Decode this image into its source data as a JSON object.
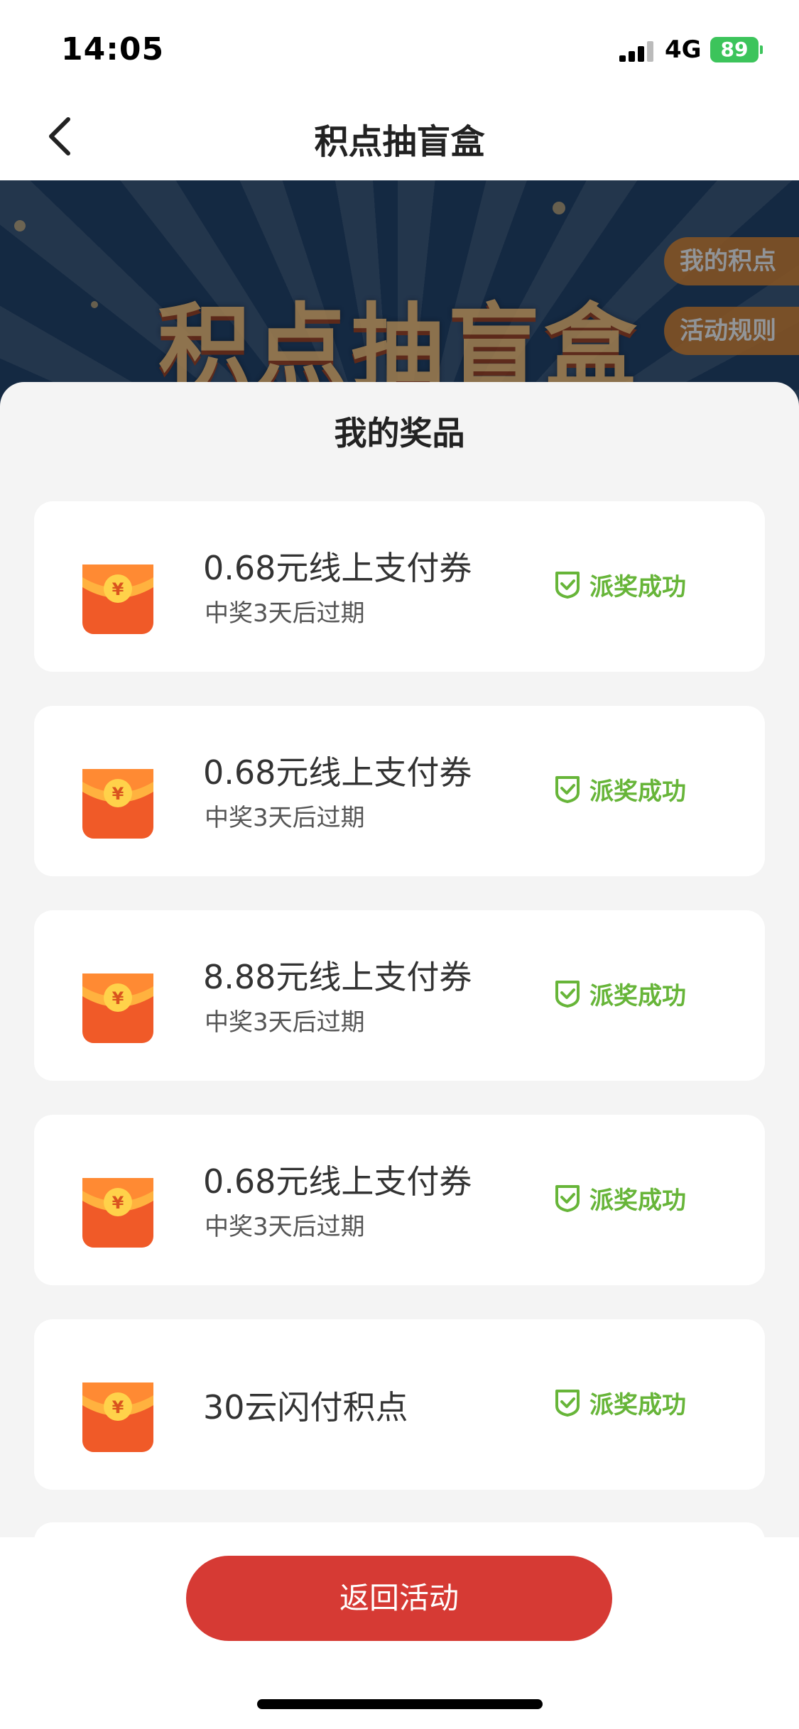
{
  "status_bar": {
    "time": "14:05",
    "network": "4G",
    "battery": "89"
  },
  "nav": {
    "title": "积点抽盲盒"
  },
  "banner": {
    "title": "积点抽盲盒",
    "side_buttons": [
      "我的积点",
      "活动规则"
    ]
  },
  "sheet": {
    "title": "我的奖品",
    "prizes": [
      {
        "name": "0.68元线上支付券",
        "subtitle": "中奖3天后过期",
        "status": "派奖成功"
      },
      {
        "name": "0.68元线上支付券",
        "subtitle": "中奖3天后过期",
        "status": "派奖成功"
      },
      {
        "name": "8.88元线上支付券",
        "subtitle": "中奖3天后过期",
        "status": "派奖成功"
      },
      {
        "name": "0.68元线上支付券",
        "subtitle": "中奖3天后过期",
        "status": "派奖成功"
      },
      {
        "name": "30云闪付积点",
        "subtitle": "",
        "status": "派奖成功"
      }
    ]
  },
  "bottom": {
    "return_label": "返回活动"
  },
  "colors": {
    "accent_red": "#d63a34",
    "success_green": "#67b539",
    "envelope_orange": "#f05a28"
  }
}
